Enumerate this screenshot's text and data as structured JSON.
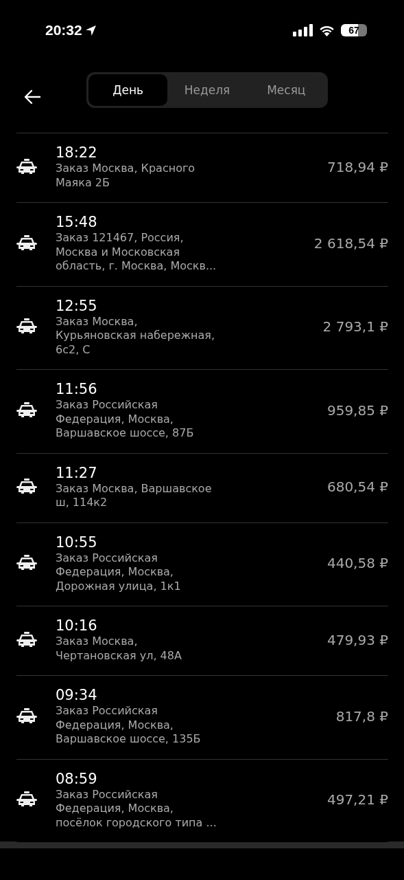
{
  "status_bar": {
    "time": "20:32",
    "battery": "67"
  },
  "tabs": [
    {
      "label": "День",
      "selected": true
    },
    {
      "label": "Неделя",
      "selected": false
    },
    {
      "label": "Месяц",
      "selected": false
    }
  ],
  "orders": [
    {
      "time": "18:22",
      "address": [
        "Заказ Москва, Красного",
        "Маяка 2Б"
      ],
      "amount": "718,94 ₽"
    },
    {
      "time": "15:48",
      "address": [
        "Заказ 121467, Россия,",
        "Москва и Московская",
        "область, г. Москва, Москв..."
      ],
      "amount": "2 618,54 ₽"
    },
    {
      "time": "12:55",
      "address": [
        "Заказ Москва,",
        "Курьяновская набережная,",
        "6с2, С"
      ],
      "amount": "2 793,1 ₽"
    },
    {
      "time": "11:56",
      "address": [
        "Заказ Российская",
        "Федерация, Москва,",
        "Варшавское шоссе, 87Б"
      ],
      "amount": "959,85 ₽"
    },
    {
      "time": "11:27",
      "address": [
        "Заказ Москва, Варшавское",
        "ш, 114к2"
      ],
      "amount": "680,54 ₽"
    },
    {
      "time": "10:55",
      "address": [
        "Заказ Российская",
        "Федерация, Москва,",
        "Дорожная улица, 1к1"
      ],
      "amount": "440,58 ₽"
    },
    {
      "time": "10:16",
      "address": [
        "Заказ Москва,",
        "Чертановская ул, 48А"
      ],
      "amount": "479,93 ₽"
    },
    {
      "time": "09:34",
      "address": [
        "Заказ Российская",
        "Федерация, Москва,",
        "Варшавское шоссе, 135Б"
      ],
      "amount": "817,8 ₽"
    },
    {
      "time": "08:59",
      "address": [
        "Заказ Российская",
        "Федерация, Москва,",
        "посёлок городского типа ..."
      ],
      "amount": "497,21 ₽"
    }
  ]
}
